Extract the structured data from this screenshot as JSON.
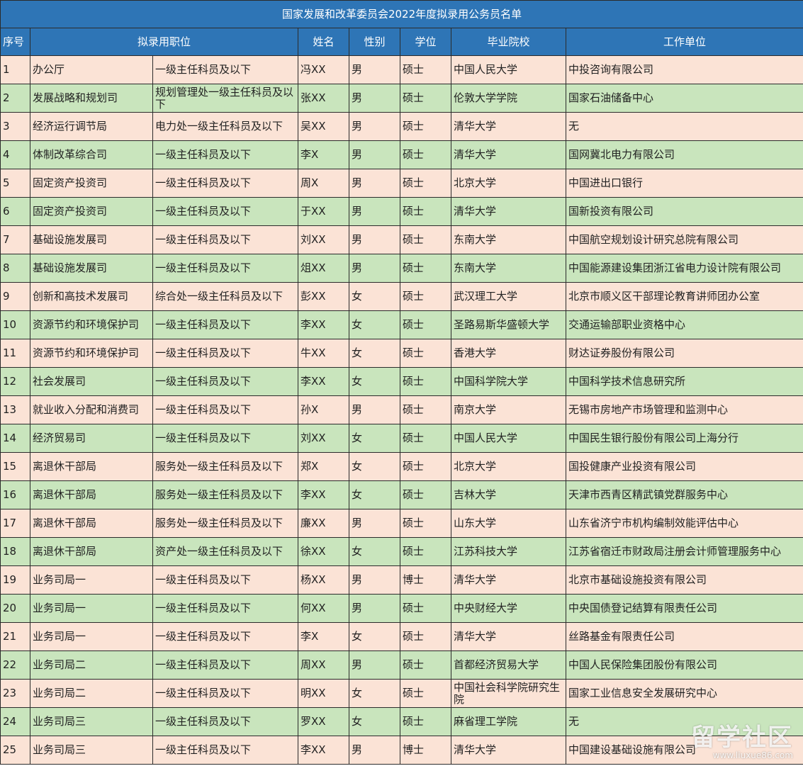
{
  "title": "国家发展和改革委员会2022年度拟录用公务员名单",
  "headers": {
    "seq": "序号",
    "position": "拟录用职位",
    "name": "姓名",
    "gender": "性别",
    "degree": "学位",
    "school": "毕业院校",
    "employer": "工作单位"
  },
  "rows": [
    [
      "1",
      "办公厅",
      "一级主任科员及以下",
      "冯XX",
      "男",
      "硕士",
      "中国人民大学",
      "中投咨询有限公司"
    ],
    [
      "2",
      "发展战略和规划司",
      "规划管理处一级主任科员及以下",
      "张XX",
      "男",
      "硕士",
      "伦敦大学学院",
      "国家石油储备中心"
    ],
    [
      "3",
      "经济运行调节局",
      "电力处一级主任科员及以下",
      "吴XX",
      "男",
      "硕士",
      "清华大学",
      "无"
    ],
    [
      "4",
      "体制改革综合司",
      "一级主任科员及以下",
      "李X",
      "男",
      "硕士",
      "清华大学",
      "国网冀北电力有限公司"
    ],
    [
      "5",
      "固定资产投资司",
      "一级主任科员及以下",
      "周X",
      "男",
      "硕士",
      "北京大学",
      "中国进出口银行"
    ],
    [
      "6",
      "固定资产投资司",
      "一级主任科员及以下",
      "于XX",
      "男",
      "硕士",
      "清华大学",
      "国新投资有限公司"
    ],
    [
      "7",
      "基础设施发展司",
      "一级主任科员及以下",
      "刘XX",
      "男",
      "硕士",
      "东南大学",
      "中国航空规划设计研究总院有限公司"
    ],
    [
      "8",
      "基础设施发展司",
      "一级主任科员及以下",
      "俎XX",
      "男",
      "硕士",
      "东南大学",
      "中国能源建设集团浙江省电力设计院有限公司"
    ],
    [
      "9",
      "创新和高技术发展司",
      "综合处一级主任科员及以下",
      "彭XX",
      "女",
      "硕士",
      "武汉理工大学",
      "北京市顺义区干部理论教育讲师团办公室"
    ],
    [
      "10",
      "资源节约和环境保护司",
      "一级主任科员及以下",
      "李XX",
      "女",
      "硕士",
      "圣路易斯华盛顿大学",
      "交通运输部职业资格中心"
    ],
    [
      "11",
      "资源节约和环境保护司",
      "一级主任科员及以下",
      "牛XX",
      "女",
      "硕士",
      "香港大学",
      "财达证券股份有限公司"
    ],
    [
      "12",
      "社会发展司",
      "一级主任科员及以下",
      "李XX",
      "女",
      "硕士",
      "中国科学院大学",
      "中国科学技术信息研究所"
    ],
    [
      "13",
      "就业收入分配和消费司",
      "一级主任科员及以下",
      "孙X",
      "男",
      "硕士",
      "南京大学",
      "无锡市房地产市场管理和监测中心"
    ],
    [
      "14",
      "经济贸易司",
      "一级主任科员及以下",
      "刘XX",
      "女",
      "硕士",
      "中国人民大学",
      "中国民生银行股份有限公司上海分行"
    ],
    [
      "15",
      "离退休干部局",
      "服务处一级主任科员及以下",
      "郑X",
      "女",
      "硕士",
      "北京大学",
      "国投健康产业投资有限公司"
    ],
    [
      "16",
      "离退休干部局",
      "服务处一级主任科员及以下",
      "李XX",
      "女",
      "硕士",
      "吉林大学",
      "天津市西青区精武镇党群服务中心"
    ],
    [
      "17",
      "离退休干部局",
      "服务处一级主任科员及以下",
      "廉XX",
      "男",
      "硕士",
      "山东大学",
      "山东省济宁市机构编制效能评估中心"
    ],
    [
      "18",
      "离退休干部局",
      "资产处一级主任科员及以下",
      "徐XX",
      "女",
      "硕士",
      "江苏科技大学",
      "江苏省宿迁市财政局注册会计师管理服务中心"
    ],
    [
      "19",
      "业务司局一",
      "一级主任科员及以下",
      "杨XX",
      "男",
      "博士",
      "清华大学",
      "北京市基础设施投资有限公司"
    ],
    [
      "20",
      "业务司局一",
      "一级主任科员及以下",
      "何XX",
      "男",
      "硕士",
      "中央财经大学",
      "中央国债登记结算有限责任公司"
    ],
    [
      "21",
      "业务司局一",
      "一级主任科员及以下",
      "李X",
      "女",
      "硕士",
      "清华大学",
      "丝路基金有限责任公司"
    ],
    [
      "22",
      "业务司局二",
      "一级主任科员及以下",
      "周XX",
      "男",
      "硕士",
      "首都经济贸易大学",
      "中国人民保险集团股份有限公司"
    ],
    [
      "23",
      "业务司局二",
      "一级主任科员及以下",
      "明XX",
      "女",
      "硕士",
      "中国社会科学院研究生院",
      "国家工业信息安全发展研究中心"
    ],
    [
      "24",
      "业务司局三",
      "一级主任科员及以下",
      "罗XX",
      "女",
      "硕士",
      "麻省理工学院",
      "无"
    ],
    [
      "25",
      "业务司局三",
      "一级主任科员及以下",
      "李XX",
      "男",
      "博士",
      "清华大学",
      "中国建设基础设施有限公司"
    ]
  ],
  "watermark": {
    "brand": "留学社区",
    "url": "www.liuxue86.com"
  }
}
